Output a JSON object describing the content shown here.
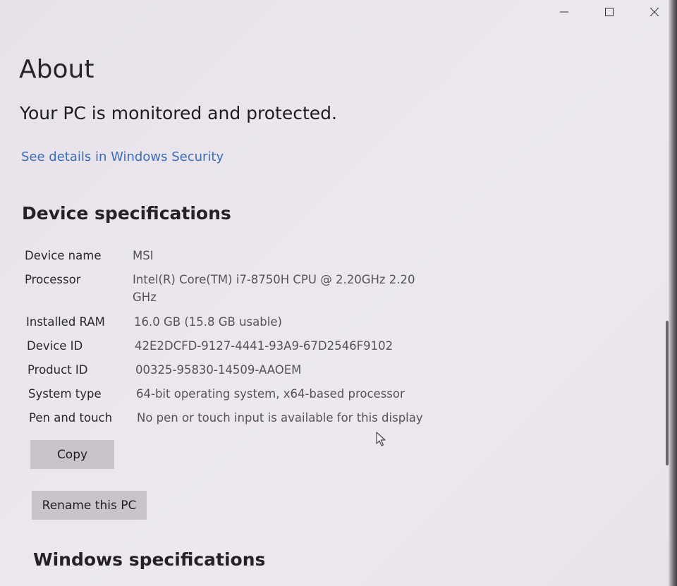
{
  "window": {
    "controls": [
      "minimize-icon",
      "maximize-icon",
      "close-icon"
    ]
  },
  "page": {
    "title": "About",
    "protection_message": "Your PC is monitored and protected.",
    "security_link": "See details in Windows Security"
  },
  "device_specs": {
    "heading": "Device specifications",
    "rows": [
      {
        "label": "Device name",
        "value": "MSI"
      },
      {
        "label": "Processor",
        "value": "Intel(R) Core(TM) i7-8750H CPU @ 2.20GHz   2.20 GHz"
      },
      {
        "label": "Installed RAM",
        "value": "16.0 GB (15.8 GB usable)"
      },
      {
        "label": "Device ID",
        "value": "42E2DCFD-9127-4441-93A9-67D2546F9102"
      },
      {
        "label": "Product ID",
        "value": "00325-95830-14509-AAOEM"
      },
      {
        "label": "System type",
        "value": "64-bit operating system, x64-based processor"
      },
      {
        "label": "Pen and touch",
        "value": "No pen or touch input is available for this display"
      }
    ]
  },
  "buttons": {
    "copy": "Copy",
    "rename": "Rename this PC"
  },
  "windows_specs": {
    "heading": "Windows specifications"
  },
  "colors": {
    "link": "#3c6cb5",
    "button_bg": "#c9c4cb",
    "background": "#ebe6ee"
  }
}
